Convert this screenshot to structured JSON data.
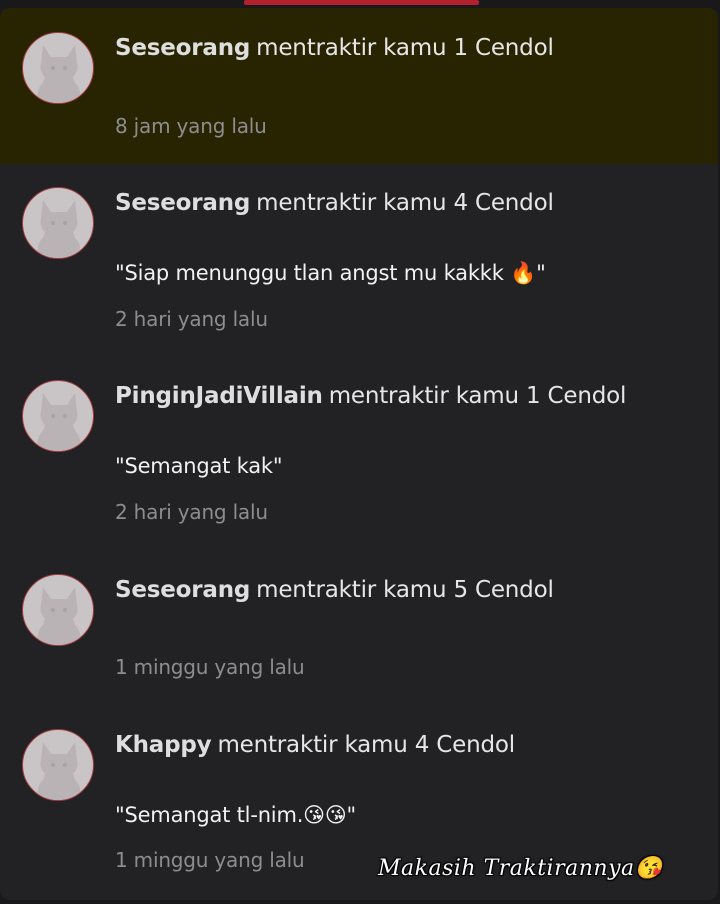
{
  "notifications": [
    {
      "name": "Seseorang",
      "action": "mentraktir kamu 1 Cendol",
      "message": "",
      "time": "8 jam yang lalu",
      "highlighted": true
    },
    {
      "name": "Seseorang",
      "action": "mentraktir kamu 4 Cendol",
      "message": "\"Siap menunggu tlan angst mu kakkk 🔥\"",
      "time": "2 hari yang lalu",
      "highlighted": false
    },
    {
      "name": "PinginJadiVillain",
      "action": "mentraktir kamu 1 Cendol",
      "message": "\"Semangat kak\"",
      "time": "2 hari yang lalu",
      "highlighted": false
    },
    {
      "name": "Seseorang",
      "action": "mentraktir kamu 5 Cendol",
      "message": "",
      "time": "1 minggu yang lalu",
      "highlighted": false
    },
    {
      "name": "Khappy",
      "action": "mentraktir kamu 4 Cendol",
      "message": "\"Semangat tl-nim.😘😘\"",
      "time": "1 minggu yang lalu",
      "highlighted": false
    }
  ],
  "overlay_caption": "Makasih Traktirannya😘",
  "colors": {
    "accent": "#b3202e",
    "highlight_bg": "#282402",
    "panel_bg": "#222224"
  }
}
